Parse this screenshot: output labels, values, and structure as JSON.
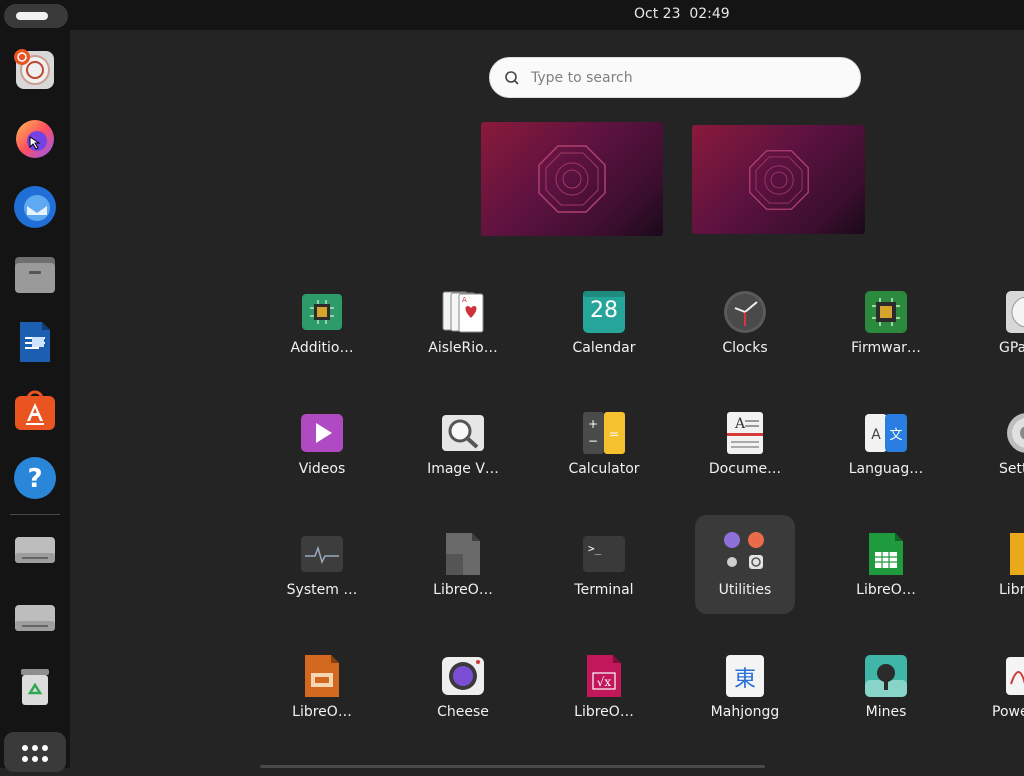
{
  "topbar": {
    "datetime": "Oct 23  02:49"
  },
  "search": {
    "placeholder": "Type to search",
    "value": ""
  },
  "dock": {
    "items": [
      {
        "name": "Ubuntu Help / installer"
      },
      {
        "name": "Firefox"
      },
      {
        "name": "Thunderbird"
      },
      {
        "name": "Files"
      },
      {
        "name": "LibreOffice Writer"
      },
      {
        "name": "App Center"
      },
      {
        "name": "Help"
      },
      {
        "name": "Drive"
      },
      {
        "name": "Drive"
      },
      {
        "name": "Trash"
      }
    ]
  },
  "apps": {
    "row1": [
      {
        "label": "Additio…"
      },
      {
        "label": "AisleRio…"
      },
      {
        "label": "Calendar",
        "day": "28"
      },
      {
        "label": "Clocks"
      },
      {
        "label": "Firmwar…"
      },
      {
        "label": "GPa"
      }
    ],
    "row2": [
      {
        "label": "Videos"
      },
      {
        "label": "Image V…"
      },
      {
        "label": "Calculator"
      },
      {
        "label": "Docume…"
      },
      {
        "label": "Languag…"
      },
      {
        "label": "Sett"
      }
    ],
    "row3": [
      {
        "label": "System …"
      },
      {
        "label": "LibreO…"
      },
      {
        "label": "Terminal"
      },
      {
        "label": "Utilities"
      },
      {
        "label": "LibreO…"
      },
      {
        "label": "Libre"
      }
    ],
    "row4": [
      {
        "label": "LibreO…"
      },
      {
        "label": "Cheese"
      },
      {
        "label": "LibreO…"
      },
      {
        "label": "Mahjongg"
      },
      {
        "label": "Mines"
      },
      {
        "label": "Powe"
      }
    ]
  },
  "colors": {
    "panel": "#141414",
    "background": "#242424",
    "accent": "#e95420"
  }
}
